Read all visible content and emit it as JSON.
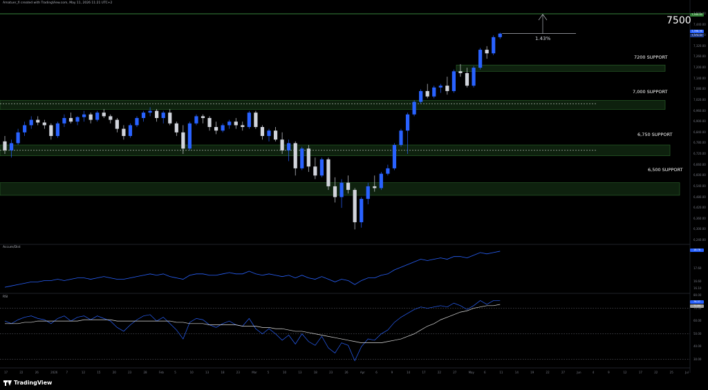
{
  "header": {
    "attribution": "Amatuer_fi created with TradingView.com, May 11, 2026 11:21 UTC+2"
  },
  "target": {
    "label": "7500",
    "change_pct": "1.43%"
  },
  "supports": [
    {
      "label": "7200 SUPPORT"
    },
    {
      "label": "7,000 SUPPORT"
    },
    {
      "label": "6,750 SUPPORT"
    },
    {
      "label": "6,500 SUPPORT"
    }
  ],
  "indicators": {
    "accum": "Accum/Dist",
    "rsi": "RSI"
  },
  "brand": {
    "name": "TradingView"
  },
  "price_axis": [
    "7,500.00",
    "7,440.00",
    "7,380.00",
    "7,320.00",
    "7,260.00",
    "7,200.00",
    "7,140.00",
    "7,080.00",
    "7,020.00",
    "6,960.00",
    "6,900.00",
    "6,840.00",
    "6,780.00",
    "6,720.00",
    "6,660.00",
    "6,600.00",
    "6,540.00",
    "6,480.00",
    "6,420.00",
    "6,360.00",
    "6,300.00",
    "6,240.00"
  ],
  "price_badges": {
    "target": "7,500.00",
    "last": "7,398.36",
    "last2": "7,374.10"
  },
  "ad_axis": [
    "18.90",
    "17.60",
    "16.60",
    "16.10"
  ],
  "ad_badge": "18.78",
  "rsi_axis": [
    "80.00",
    "70.00",
    "60.00",
    "50.00",
    "40.00",
    "30.00"
  ],
  "rsi_badges": {
    "rsi": "76.37",
    "ma": "72.84"
  },
  "time_axis": [
    "17",
    "22",
    "26",
    "2026",
    "7",
    "12",
    "15",
    "20",
    "23",
    "28",
    "Feb",
    "5",
    "10",
    "13",
    "18",
    "23",
    "Mar",
    "5",
    "10",
    "13",
    "18",
    "23",
    "26",
    "Apr",
    "6",
    "9",
    "14",
    "17",
    "22",
    "27",
    "May",
    "6",
    "11",
    "14",
    "19",
    "22",
    "27",
    "Jun",
    "4",
    "9",
    "12",
    "17",
    "22",
    "25",
    "Jul"
  ],
  "colors": {
    "up": "#2962ff",
    "down": "#d1d4dc",
    "zone": "#1a3d1a",
    "zone_border": "#2e6b2e",
    "line": "#2962ff",
    "ma": "#e0e0e0"
  },
  "candles": [
    [
      6790,
      6820,
      6720,
      6740
    ],
    [
      6740,
      6800,
      6700,
      6780
    ],
    [
      6780,
      6860,
      6770,
      6840
    ],
    [
      6840,
      6900,
      6820,
      6880
    ],
    [
      6880,
      6930,
      6860,
      6910
    ],
    [
      6910,
      6930,
      6880,
      6895
    ],
    [
      6895,
      6910,
      6860,
      6880
    ],
    [
      6880,
      6890,
      6800,
      6820
    ],
    [
      6820,
      6900,
      6810,
      6890
    ],
    [
      6890,
      6940,
      6870,
      6920
    ],
    [
      6920,
      6950,
      6890,
      6900
    ],
    [
      6900,
      6930,
      6880,
      6925
    ],
    [
      6925,
      6960,
      6900,
      6940
    ],
    [
      6940,
      6950,
      6890,
      6910
    ],
    [
      6910,
      6960,
      6900,
      6950
    ],
    [
      6950,
      6970,
      6920,
      6930
    ],
    [
      6930,
      6940,
      6890,
      6910
    ],
    [
      6910,
      6920,
      6840,
      6860
    ],
    [
      6860,
      6880,
      6800,
      6820
    ],
    [
      6820,
      6890,
      6810,
      6880
    ],
    [
      6880,
      6930,
      6870,
      6920
    ],
    [
      6920,
      6960,
      6900,
      6950
    ],
    [
      6950,
      6980,
      6930,
      6960
    ],
    [
      6960,
      6970,
      6900,
      6920
    ],
    [
      6920,
      6960,
      6890,
      6950
    ],
    [
      6950,
      6970,
      6880,
      6890
    ],
    [
      6890,
      6900,
      6820,
      6840
    ],
    [
      6840,
      6880,
      6720,
      6750
    ],
    [
      6750,
      6900,
      6740,
      6890
    ],
    [
      6890,
      6940,
      6880,
      6930
    ],
    [
      6930,
      6940,
      6890,
      6920
    ],
    [
      6920,
      6930,
      6850,
      6870
    ],
    [
      6870,
      6900,
      6830,
      6850
    ],
    [
      6850,
      6890,
      6840,
      6880
    ],
    [
      6880,
      6910,
      6860,
      6900
    ],
    [
      6900,
      6920,
      6860,
      6880
    ],
    [
      6880,
      6900,
      6850,
      6870
    ],
    [
      6870,
      6960,
      6860,
      6950
    ],
    [
      6950,
      6960,
      6860,
      6870
    ],
    [
      6870,
      6880,
      6800,
      6820
    ],
    [
      6820,
      6860,
      6790,
      6850
    ],
    [
      6850,
      6870,
      6790,
      6800
    ],
    [
      6800,
      6840,
      6720,
      6740
    ],
    [
      6740,
      6800,
      6680,
      6780
    ],
    [
      6780,
      6790,
      6600,
      6640
    ],
    [
      6640,
      6760,
      6630,
      6750
    ],
    [
      6750,
      6770,
      6620,
      6650
    ],
    [
      6650,
      6700,
      6580,
      6600
    ],
    [
      6600,
      6700,
      6590,
      6690
    ],
    [
      6690,
      6700,
      6520,
      6540
    ],
    [
      6540,
      6590,
      6450,
      6480
    ],
    [
      6480,
      6580,
      6420,
      6560
    ],
    [
      6560,
      6600,
      6500,
      6520
    ],
    [
      6520,
      6530,
      6300,
      6340
    ],
    [
      6340,
      6480,
      6310,
      6470
    ],
    [
      6470,
      6560,
      6440,
      6540
    ],
    [
      6540,
      6600,
      6510,
      6530
    ],
    [
      6530,
      6620,
      6520,
      6610
    ],
    [
      6610,
      6660,
      6600,
      6640
    ],
    [
      6640,
      6780,
      6630,
      6770
    ],
    [
      6770,
      6860,
      6760,
      6850
    ],
    [
      6850,
      6950,
      6720,
      6940
    ],
    [
      6940,
      7020,
      6930,
      7010
    ],
    [
      7010,
      7080,
      7000,
      7070
    ],
    [
      7070,
      7110,
      7030,
      7040
    ],
    [
      7040,
      7100,
      7030,
      7090
    ],
    [
      7090,
      7110,
      7060,
      7100
    ],
    [
      7100,
      7150,
      7050,
      7070
    ],
    [
      7070,
      7190,
      7060,
      7180
    ],
    [
      7180,
      7220,
      7150,
      7170
    ],
    [
      7170,
      7200,
      7090,
      7100
    ],
    [
      7100,
      7210,
      7090,
      7200
    ],
    [
      7200,
      7310,
      7190,
      7300
    ],
    [
      7300,
      7320,
      7250,
      7280
    ],
    [
      7280,
      7380,
      7270,
      7370
    ],
    [
      7370,
      7395,
      7360,
      7390
    ]
  ],
  "ad_series": [
    16.2,
    16.3,
    16.4,
    16.5,
    16.6,
    16.6,
    16.7,
    16.7,
    16.8,
    16.7,
    16.8,
    16.9,
    16.9,
    16.8,
    16.9,
    17.0,
    16.9,
    16.8,
    16.8,
    16.9,
    17.0,
    17.1,
    17.2,
    17.1,
    17.2,
    17.0,
    16.9,
    16.8,
    17.1,
    17.2,
    17.2,
    17.1,
    17.1,
    17.2,
    17.3,
    17.2,
    17.2,
    17.4,
    17.2,
    17.1,
    17.2,
    17.1,
    17.0,
    17.1,
    16.9,
    17.1,
    16.9,
    16.8,
    17.0,
    16.8,
    16.6,
    16.8,
    16.7,
    16.4,
    16.7,
    16.9,
    16.9,
    17.1,
    17.2,
    17.5,
    17.7,
    17.9,
    18.1,
    18.3,
    18.2,
    18.3,
    18.4,
    18.3,
    18.5,
    18.5,
    18.4,
    18.6,
    18.8,
    18.7,
    18.8,
    18.9
  ],
  "rsi_series": [
    60,
    58,
    61,
    63,
    64,
    62,
    61,
    58,
    62,
    64,
    60,
    63,
    64,
    61,
    64,
    62,
    60,
    55,
    52,
    57,
    61,
    64,
    65,
    60,
    63,
    58,
    53,
    46,
    59,
    62,
    61,
    57,
    55,
    58,
    60,
    57,
    56,
    62,
    54,
    50,
    54,
    50,
    45,
    49,
    42,
    50,
    44,
    41,
    48,
    39,
    35,
    43,
    41,
    29,
    40,
    46,
    45,
    50,
    53,
    59,
    63,
    66,
    69,
    71,
    70,
    71,
    72,
    71,
    74,
    72,
    69,
    72,
    76,
    73,
    76,
    76
  ],
  "rsi_ma": [
    58,
    58,
    58,
    59,
    59,
    60,
    60,
    60,
    60,
    60,
    60,
    60,
    61,
    61,
    61,
    61,
    61,
    60,
    60,
    60,
    60,
    60,
    60,
    60,
    60,
    60,
    59,
    59,
    58,
    58,
    58,
    57,
    57,
    57,
    57,
    57,
    56,
    56,
    56,
    55,
    55,
    54,
    54,
    53,
    52,
    52,
    51,
    50,
    49,
    48,
    47,
    46,
    45,
    44,
    43,
    43,
    43,
    43,
    44,
    45,
    46,
    48,
    50,
    53,
    56,
    58,
    61,
    63,
    65,
    67,
    68,
    70,
    71,
    72,
    72,
    73
  ]
}
